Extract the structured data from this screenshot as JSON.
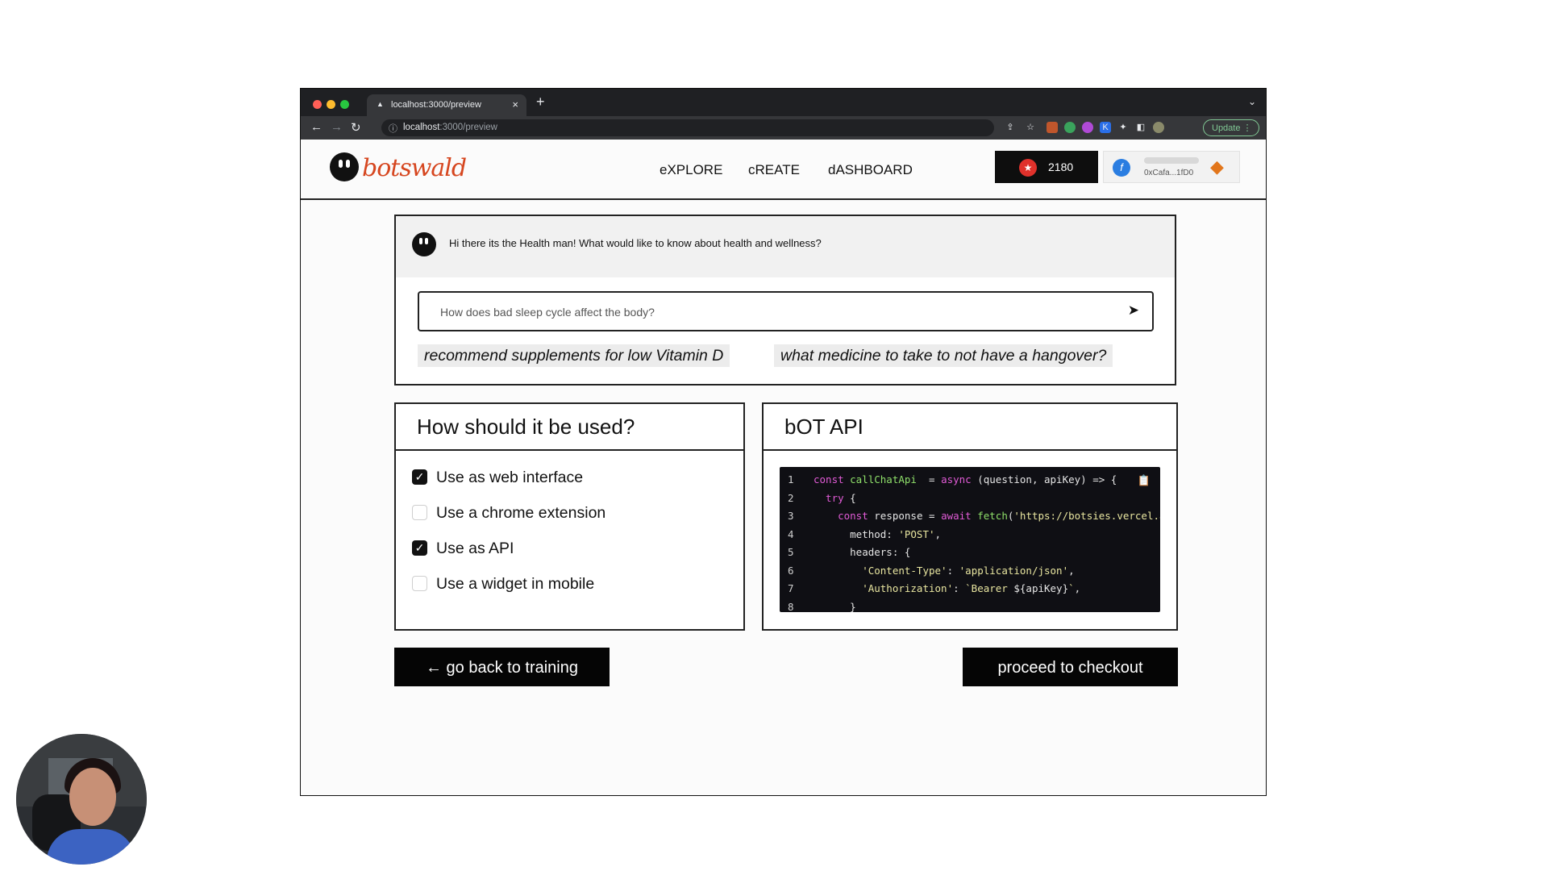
{
  "browser": {
    "tab_title": "localhost:3000/preview",
    "tab_close": "×",
    "new_tab": "+",
    "tab_menu": "⌄",
    "url_host": "localhost",
    "url_path": ":3000/preview",
    "update_label": "Update ⋮"
  },
  "header": {
    "logo_text": "botswald",
    "nav": [
      "eXPLORE",
      "cREATE",
      "dASHBOARD"
    ],
    "points_value": "2180",
    "wallet_address": "0xCafa...1fD0"
  },
  "chat": {
    "bot_message": "Hi there its the Health man! What would like to know about health and wellness?",
    "input_placeholder": "How does bad sleep cycle affect the body?",
    "suggestions": [
      "recommend supplements for low Vitamin D",
      "what medicine to take to not have a hangover?"
    ]
  },
  "usage": {
    "title": "How should it be used?",
    "options": [
      {
        "label": "Use as web interface",
        "checked": true
      },
      {
        "label": "Use a chrome extension",
        "checked": false
      },
      {
        "label": "Use as API",
        "checked": true
      },
      {
        "label": "Use a widget in mobile",
        "checked": false
      }
    ]
  },
  "api": {
    "title": "bOT API",
    "code_lines": [
      {
        "n": "1",
        "parts": [
          [
            "kw",
            "const "
          ],
          [
            "fn",
            "callChatApi"
          ],
          [
            "",
            "  = "
          ],
          [
            "kw",
            "async "
          ],
          [
            "",
            "(question, apiKey) => {"
          ]
        ]
      },
      {
        "n": "2",
        "parts": [
          [
            "kw",
            "  try "
          ],
          [
            "",
            "{"
          ]
        ]
      },
      {
        "n": "3",
        "parts": [
          [
            "kw",
            "    const "
          ],
          [
            "",
            "response = "
          ],
          [
            "kw",
            "await "
          ],
          [
            "fn",
            "fetch"
          ],
          [
            "",
            "("
          ],
          [
            "str",
            "'https://botsies.vercel.app/api/chat'"
          ],
          [
            "",
            ","
          ]
        ]
      },
      {
        "n": "4",
        "parts": [
          [
            "",
            "      method: "
          ],
          [
            "str",
            "'POST'"
          ],
          [
            "",
            ","
          ]
        ]
      },
      {
        "n": "5",
        "parts": [
          [
            "",
            "      headers: {"
          ]
        ]
      },
      {
        "n": "6",
        "parts": [
          [
            "str",
            "        'Content-Type'"
          ],
          [
            "",
            ": "
          ],
          [
            "str",
            "'application/json'"
          ],
          [
            "",
            ","
          ]
        ]
      },
      {
        "n": "7",
        "parts": [
          [
            "str",
            "        'Authorization'"
          ],
          [
            "",
            ": "
          ],
          [
            "str",
            "`Bearer "
          ],
          [
            "",
            "${apiKey}"
          ],
          [
            "str",
            "`"
          ],
          [
            "",
            ","
          ]
        ]
      },
      {
        "n": "8",
        "parts": [
          [
            "",
            "      }"
          ]
        ]
      }
    ]
  },
  "actions": {
    "back_label": "← go back to training",
    "checkout_label": "proceed to checkout"
  },
  "colors": {
    "accent": "#d6461f",
    "primary_button": "#050505",
    "points_coin": "#e0312b"
  },
  "icons": {
    "send": "paper-plane-icon",
    "copy": "clipboard-icon",
    "wallet": "metamask-fox-icon"
  }
}
